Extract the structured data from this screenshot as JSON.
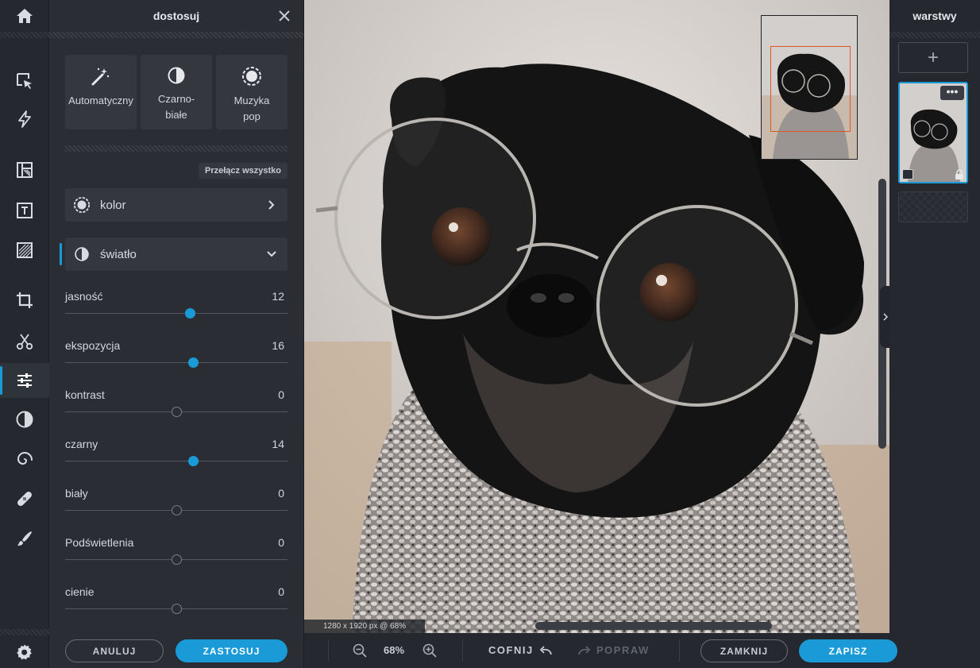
{
  "panel": {
    "title": "dostosuj",
    "presets": [
      {
        "label": "Automatyczny",
        "icon": "magic-wand-icon"
      },
      {
        "label": "Czarno-białe",
        "icon": "contrast-icon"
      },
      {
        "label": "Muzyka pop",
        "icon": "gear-flower-icon"
      }
    ],
    "toggle_all": "Przełącz wszystko",
    "sections": {
      "color": {
        "label": "kolor",
        "icon": "color-wheel-icon",
        "expanded": false
      },
      "light": {
        "label": "światło",
        "icon": "contrast-icon",
        "expanded": true
      }
    },
    "sliders": [
      {
        "label": "jasność",
        "value": "12",
        "active": true,
        "position": 0.56
      },
      {
        "label": "ekspozycja",
        "value": "16",
        "active": true,
        "position": 0.575
      },
      {
        "label": "kontrast",
        "value": "0",
        "active": false,
        "position": 0.5
      },
      {
        "label": "czarny",
        "value": "14",
        "active": true,
        "position": 0.575
      },
      {
        "label": "biały",
        "value": "0",
        "active": false,
        "position": 0.5
      },
      {
        "label": "Podświetlenia",
        "value": "0",
        "active": false,
        "position": 0.5
      },
      {
        "label": "cienie",
        "value": "0",
        "active": false,
        "position": 0.5
      }
    ],
    "cancel_label": "ANULUJ",
    "apply_label": "ZASTOSUJ"
  },
  "canvas": {
    "dimensions_label": "1280 x 1920 px @ 68%"
  },
  "bottom_bar": {
    "zoom": "68%",
    "undo_label": "COFNIJ",
    "redo_label": "POPRAW",
    "close_label": "ZAMKNIJ",
    "save_label": "ZAPISZ"
  },
  "layers": {
    "title": "warstwy",
    "add_label": "+",
    "more_label": "•••"
  },
  "colors": {
    "accent": "#1a9bd7",
    "panel_bg": "#2a2d33",
    "rail_bg": "#25282e",
    "viewport_frame": "#e0561f"
  }
}
